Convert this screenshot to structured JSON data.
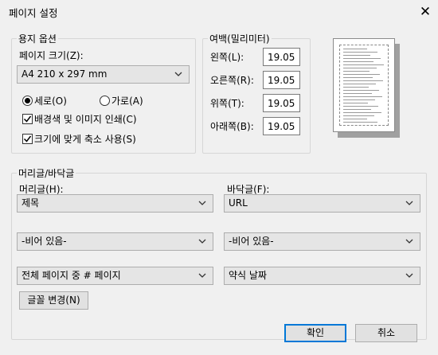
{
  "window": {
    "title": "페이지 설정",
    "close_glyph": "✕"
  },
  "paper": {
    "group_label": "용지 옵션",
    "size_label": "페이지 크기(Z):",
    "size_value": "A4 210 x 297 mm",
    "portrait_label": "세로(O)",
    "landscape_label": "가로(A)",
    "orientation": "portrait",
    "print_background_label": "배경색 및 이미지 인쇄(C)",
    "print_background_checked": true,
    "shrink_to_fit_label": "크기에 맞게 축소 사용(S)",
    "shrink_to_fit_checked": true
  },
  "margins": {
    "group_label": "여백(밀리미터)",
    "left_label": "왼쪽(L):",
    "left_value": "19.05",
    "right_label": "오른쪽(R):",
    "right_value": "19.05",
    "top_label": "위쪽(T):",
    "top_value": "19.05",
    "bottom_label": "아래쪽(B):",
    "bottom_value": "19.05"
  },
  "headers_footers": {
    "group_label": "머리글/바닥글",
    "header_label": "머리글(H):",
    "footer_label": "바닥글(F):",
    "header_1": "제목",
    "footer_1": "URL",
    "header_2": "-비어 있음-",
    "footer_2": "-비어 있음-",
    "header_3": "전체 페이지 중 # 페이지",
    "footer_3": "약식 날짜",
    "font_button": "글꼴 변경(N)"
  },
  "buttons": {
    "ok": "확인",
    "cancel": "취소"
  },
  "colors": {
    "default_button_border": "#0078d7",
    "dialog_bg": "#f0f0f0"
  }
}
